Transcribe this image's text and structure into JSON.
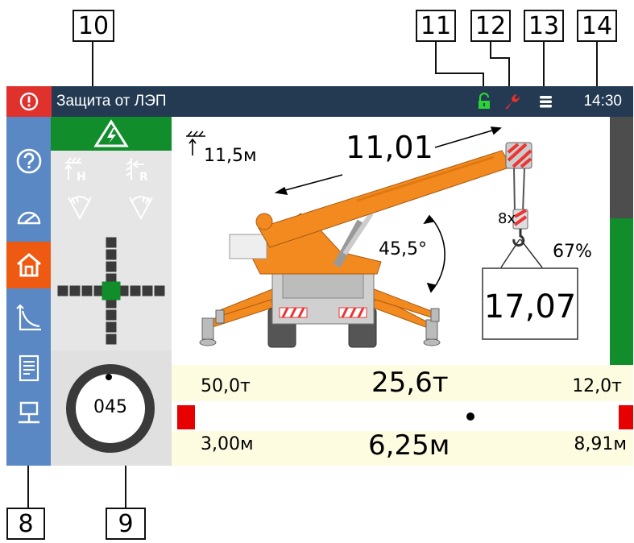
{
  "callouts": {
    "c8": "8",
    "c9": "9",
    "c10": "10",
    "c11": "11",
    "c12": "12",
    "c13": "13",
    "c14": "14"
  },
  "topbar": {
    "title": "Защита от ЛЭП",
    "time": "14:30",
    "alarm_icon": "alert-circle-icon",
    "status_icons": [
      "lock-open-icon",
      "wrench-icon",
      "menu-lines-icon"
    ]
  },
  "sidebar": {
    "items": [
      {
        "icon": "help-icon",
        "active": false
      },
      {
        "icon": "gauge-icon",
        "active": false
      },
      {
        "icon": "home-icon",
        "active": true
      },
      {
        "icon": "chart-curve-icon",
        "active": false
      },
      {
        "icon": "document-icon",
        "active": false
      },
      {
        "icon": "network-icon",
        "active": false
      }
    ]
  },
  "left_panel": {
    "power_line_icon": "high-voltage-icon",
    "limit_buttons": [
      "height-limit-icon",
      "radius-limit-icon",
      "angle-limit-left-icon",
      "angle-limit-right-icon"
    ],
    "level_indicator": "level-indicator",
    "slew_value": "045"
  },
  "crane_view": {
    "height": "11,5м",
    "boom_length": "11,01",
    "boom_angle": "45,5°",
    "reeving": "8x",
    "load_percent": "67%",
    "load": "17,07",
    "load_bar_fraction": 0.59
  },
  "bottom": {
    "max_capacity": "50,0т",
    "current_capacity": "25,6т",
    "min_capacity": "12,0т",
    "min_radius": "3,00м",
    "current_radius": "6,25м",
    "max_radius": "8,91м"
  },
  "colors": {
    "topbar": "#233a52",
    "sidebar": "#5a88c4",
    "active": "#ef5a12",
    "green": "#118d2c",
    "crane": "#f38a20",
    "alarm": "#e0322d"
  }
}
